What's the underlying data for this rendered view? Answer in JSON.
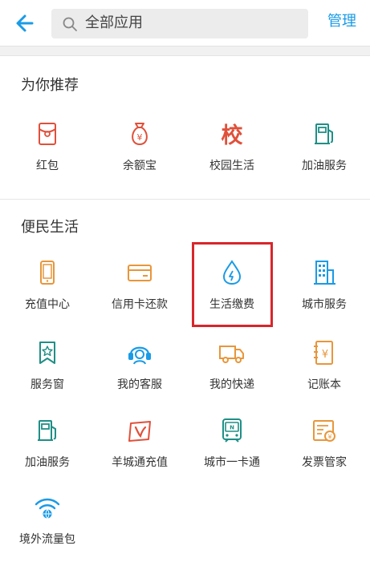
{
  "header": {
    "search_placeholder": "全部应用",
    "manage_label": "管理"
  },
  "recommend": {
    "title": "为你推荐",
    "items": [
      {
        "label": "红包",
        "icon": "red-envelope-icon"
      },
      {
        "label": "余额宝",
        "icon": "money-bag-icon"
      },
      {
        "label": "校园生活",
        "icon": "campus-icon",
        "glyph": "校"
      },
      {
        "label": "加油服务",
        "icon": "fuel-pump-icon"
      }
    ]
  },
  "life": {
    "title": "便民生活",
    "items": [
      {
        "label": "充值中心",
        "icon": "phone-icon"
      },
      {
        "label": "信用卡还款",
        "icon": "credit-card-icon"
      },
      {
        "label": "生活缴费",
        "icon": "water-drop-icon",
        "highlighted": true
      },
      {
        "label": "城市服务",
        "icon": "building-icon"
      },
      {
        "label": "服务窗",
        "icon": "bookmark-star-icon"
      },
      {
        "label": "我的客服",
        "icon": "headset-icon"
      },
      {
        "label": "我的快递",
        "icon": "truck-icon"
      },
      {
        "label": "记账本",
        "icon": "ledger-icon"
      },
      {
        "label": "加油服务",
        "icon": "fuel-pump-icon"
      },
      {
        "label": "羊城通充值",
        "icon": "yct-card-icon"
      },
      {
        "label": "城市一卡通",
        "icon": "transit-card-icon"
      },
      {
        "label": "发票管家",
        "icon": "invoice-icon"
      },
      {
        "label": "境外流量包",
        "icon": "wifi-globe-icon"
      }
    ]
  },
  "colors": {
    "accent": "#1a9be6",
    "red": "#e0503a",
    "orange": "#e8963a",
    "teal": "#1f8f86",
    "highlight_border": "#d8262b"
  }
}
